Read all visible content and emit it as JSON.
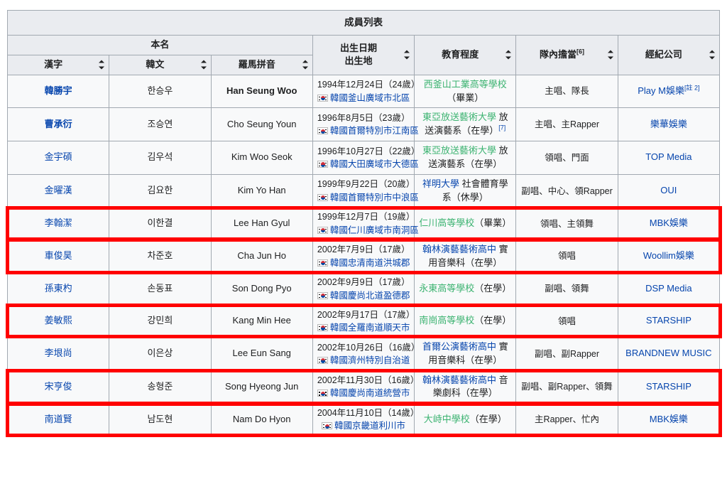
{
  "table": {
    "caption": "成員列表",
    "group_headers": [
      {
        "label": "本名",
        "colspan": 3
      },
      {
        "label_line1": "出生日期",
        "label_line2": "出生地",
        "sortable": true
      },
      {
        "label": "教育程度",
        "sortable": true
      },
      {
        "label": "隊內擔當",
        "ref": "[6]",
        "sortable": true
      },
      {
        "label": "經紀公司",
        "sortable": true
      }
    ],
    "sub_headers": [
      {
        "label": "漢字",
        "sortable": true
      },
      {
        "label": "韓文",
        "sortable": true
      },
      {
        "label": "羅馬拼音",
        "sortable": true
      }
    ],
    "rows": [
      {
        "hanja": "韓勝宇",
        "hangul": "한승우",
        "romaja": "Han Seung Woo",
        "birth_date": "1994年12月24日（24歲）",
        "birth_place": "韓國釜山廣域市北區",
        "edu_link": "西釜山工業高等學校",
        "edu_link_color": "visited",
        "edu_rest": "（畢業）",
        "edu_ref": "",
        "role": "主唱、隊長",
        "agency": "Play M娛樂",
        "agency_ref": "[註 2]",
        "highlighted": false,
        "hanja_bold": true,
        "romaja_bold": true
      },
      {
        "hanja": "曹承衍",
        "hangul": "조승연",
        "romaja": "Cho Seung Youn",
        "birth_date": "1996年8月5日（23歲）",
        "birth_place": "韓國首爾特別市江南區",
        "edu_link": "東亞放送藝術大學",
        "edu_link_color": "visited",
        "edu_rest": " 放送演藝系（在學）",
        "edu_ref": "[7]",
        "role": "主唱、主Rapper",
        "agency": "樂華娛樂",
        "agency_ref": "",
        "highlighted": false,
        "hanja_bold": true,
        "romaja_bold": false
      },
      {
        "hanja": "金宇碩",
        "hangul": "김우석",
        "romaja": "Kim Woo Seok",
        "birth_date": "1996年10月27日（22歲）",
        "birth_place": "韓國大田廣域市大德區",
        "edu_link": "東亞放送藝術大學",
        "edu_link_color": "visited",
        "edu_rest": " 放送演藝系（在學）",
        "edu_ref": "",
        "role": "領唱、門面",
        "agency": "TOP Media",
        "agency_ref": "",
        "highlighted": false,
        "hanja_bold": false,
        "romaja_bold": false
      },
      {
        "hanja": "金曜漢",
        "hangul": "김요한",
        "romaja": "Kim Yo Han",
        "birth_date": "1999年9月22日（20歲）",
        "birth_place": "韓國首爾特別市中浪區",
        "edu_link": "祥明大學",
        "edu_link_color": "normal",
        "edu_rest": " 社會體育學系（休學）",
        "edu_ref": "",
        "role": "副唱、中心、領Rapper",
        "agency": "OUI",
        "agency_ref": "",
        "highlighted": false,
        "hanja_bold": false,
        "romaja_bold": false
      },
      {
        "hanja": "李翰潔",
        "hangul": "이한결",
        "romaja": "Lee Han Gyul",
        "birth_date": "1999年12月7日（19歲）",
        "birth_place": "韓國仁川廣域市南洞區",
        "edu_link": "仁川高等學校",
        "edu_link_color": "visited",
        "edu_rest": "（畢業）",
        "edu_ref": "",
        "role": "領唱、主領舞",
        "agency": "MBK娛樂",
        "agency_ref": "",
        "highlighted": true,
        "hanja_bold": false,
        "romaja_bold": false
      },
      {
        "hanja": "車俊昊",
        "hangul": "차준호",
        "romaja": "Cha Jun Ho",
        "birth_date": "2002年7月9日（17歲）",
        "birth_place": "韓國忠清南道洪城郡",
        "edu_link": "翰林演藝藝術高中",
        "edu_link_color": "normal",
        "edu_rest": " 實用音樂科（在學）",
        "edu_ref": "",
        "role": "領唱",
        "agency": "Woollim娛樂",
        "agency_ref": "",
        "highlighted": true,
        "hanja_bold": false,
        "romaja_bold": false
      },
      {
        "hanja": "孫東杓",
        "hangul": "손동표",
        "romaja": "Son Dong Pyo",
        "birth_date": "2002年9月9日（17歲）",
        "birth_place": "韓國慶尚北道盈德郡",
        "edu_link": "永東高等學校",
        "edu_link_color": "visited",
        "edu_rest": "（在學）",
        "edu_ref": "",
        "role": "副唱、領舞",
        "agency": "DSP Media",
        "agency_ref": "",
        "highlighted": false,
        "hanja_bold": false,
        "romaja_bold": false
      },
      {
        "hanja": "姜敏熙",
        "hangul": "강민희",
        "romaja": "Kang Min Hee",
        "birth_date": "2002年9月17日（17歲）",
        "birth_place": "韓國全羅南道順天市",
        "edu_link": "南崗高等學校",
        "edu_link_color": "visited",
        "edu_rest": "（在學）",
        "edu_ref": "",
        "role": "領唱",
        "agency": "STARSHIP",
        "agency_ref": "",
        "highlighted": true,
        "hanja_bold": false,
        "romaja_bold": false
      },
      {
        "hanja": "李垠尚",
        "hangul": "이은상",
        "romaja": "Lee Eun Sang",
        "birth_date": "2002年10月26日（16歲）",
        "birth_place": "韓國濟州特別自治道",
        "edu_link": "首爾公演藝術高中",
        "edu_link_color": "normal",
        "edu_rest": " 實用音樂科（在學）",
        "edu_ref": "",
        "role": "副唱、副Rapper",
        "agency": "BRANDNEW MUSIC",
        "agency_ref": "",
        "highlighted": false,
        "hanja_bold": false,
        "romaja_bold": false
      },
      {
        "hanja": "宋亨俊",
        "hangul": "송형준",
        "romaja": "Song Hyeong Jun",
        "birth_date": "2002年11月30日（16歲）",
        "birth_place": "韓國慶尚南道統營市",
        "edu_link": "翰林演藝藝術高中",
        "edu_link_color": "normal",
        "edu_rest": " 音樂劇科（在學）",
        "edu_ref": "",
        "role": "副唱、副Rapper、領舞",
        "agency": "STARSHIP",
        "agency_ref": "",
        "highlighted": true,
        "hanja_bold": false,
        "romaja_bold": false
      },
      {
        "hanja": "南道賢",
        "hangul": "남도현",
        "romaja": "Nam Do Hyon",
        "birth_date": "2004年11月10日（14歲）",
        "birth_place": "韓國京畿道利川市",
        "edu_link": "大峙中學校",
        "edu_link_color": "visited",
        "edu_rest": "（在學）",
        "edu_ref": "",
        "role": "主Rapper、忙內",
        "agency": "MBK娛樂",
        "agency_ref": "",
        "highlighted": true,
        "hanja_bold": false,
        "romaja_bold": false
      }
    ]
  },
  "colors": {
    "link": "#0645ad",
    "visited_link": "#3cb371",
    "header_bg": "#eaecf0",
    "cell_bg": "#f8f9fa",
    "border": "#a2a9b1",
    "highlight": "#ff0000"
  },
  "annotation": {
    "highlighted_row_indices": [
      4,
      5,
      7,
      9,
      10
    ],
    "box_color": "#ff0000"
  }
}
